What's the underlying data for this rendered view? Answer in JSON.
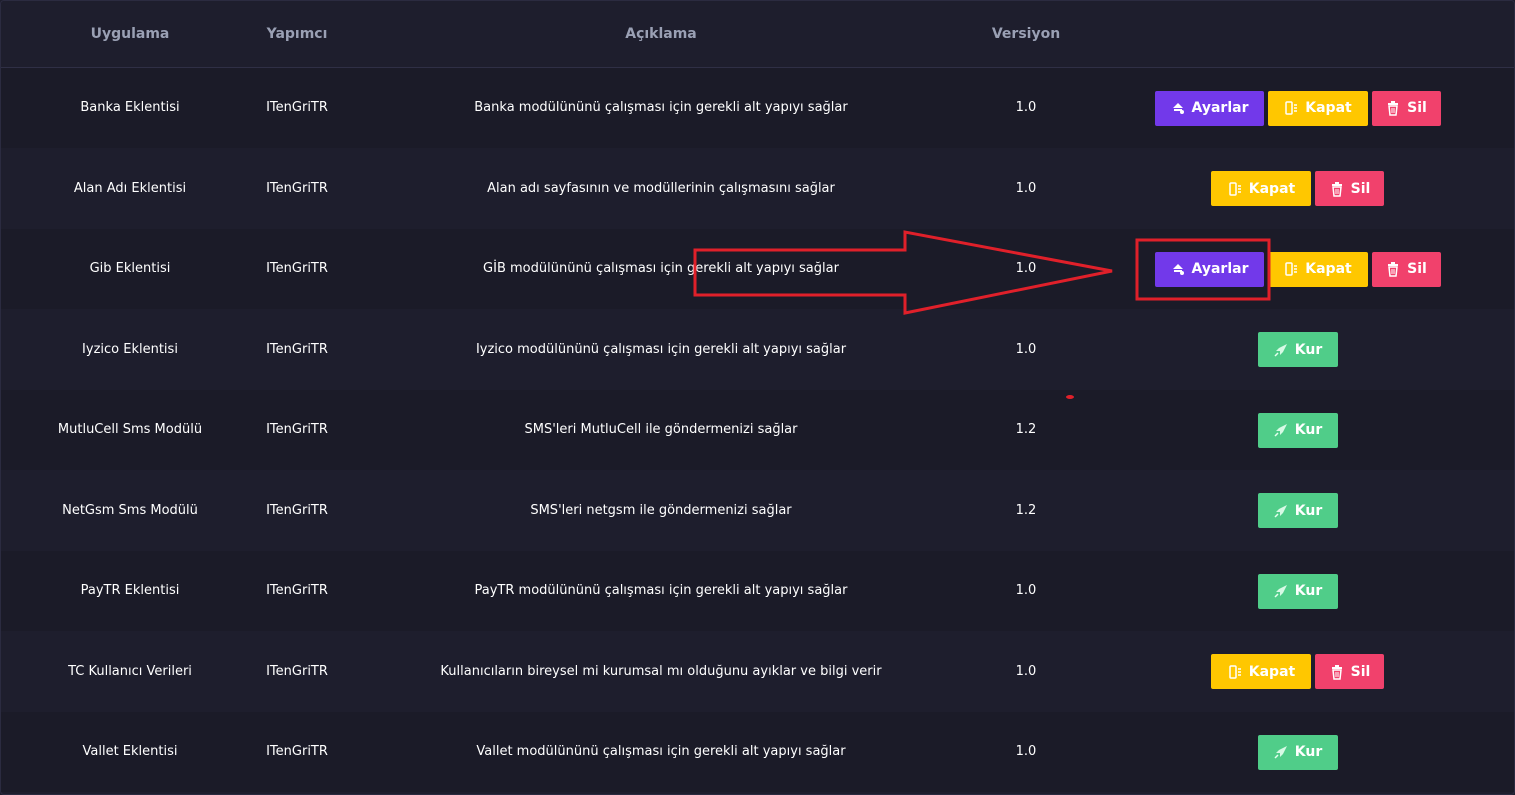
{
  "table": {
    "headers": {
      "app": "Uygulama",
      "developer": "Yapımcı",
      "description": "Açıklama",
      "version": "Versiyon"
    },
    "buttons": {
      "settings": "Ayarlar",
      "close": "Kapat",
      "delete": "Sil",
      "install": "Kur"
    },
    "rows": [
      {
        "app": "Banka Eklentisi",
        "developer": "ITenGriTR",
        "description": "Banka modülününü çalışması için gerekli alt yapıyı sağlar",
        "version": "1.0",
        "actions": [
          "settings",
          "close",
          "delete"
        ]
      },
      {
        "app": "Alan Adı Eklentisi",
        "developer": "ITenGriTR",
        "description": "Alan adı sayfasının ve modüllerinin çalışmasını sağlar",
        "version": "1.0",
        "actions": [
          "close",
          "delete"
        ]
      },
      {
        "app": "Gib Eklentisi",
        "developer": "ITenGriTR",
        "description": "GİB modülününü çalışması için gerekli alt yapıyı sağlar",
        "version": "1.0",
        "actions": [
          "settings",
          "close",
          "delete"
        ]
      },
      {
        "app": "Iyzico Eklentisi",
        "developer": "ITenGriTR",
        "description": "Iyzico modülününü çalışması için gerekli alt yapıyı sağlar",
        "version": "1.0",
        "actions": [
          "install"
        ]
      },
      {
        "app": "MutluCell Sms Modülü",
        "developer": "ITenGriTR",
        "description": "SMS'leri MutluCell ile göndermenizi sağlar",
        "version": "1.2",
        "actions": [
          "install"
        ]
      },
      {
        "app": "NetGsm Sms Modülü",
        "developer": "ITenGriTR",
        "description": "SMS'leri netgsm ile göndermenizi sağlar",
        "version": "1.2",
        "actions": [
          "install"
        ]
      },
      {
        "app": "PayTR Eklentisi",
        "developer": "ITenGriTR",
        "description": "PayTR modülününü çalışması için gerekli alt yapıyı sağlar",
        "version": "1.0",
        "actions": [
          "install"
        ]
      },
      {
        "app": "TC Kullanıcı Verileri",
        "developer": "ITenGriTR",
        "description": "Kullanıcıların bireysel mi kurumsal mı olduğunu ayıklar ve bilgi verir",
        "version": "1.0",
        "actions": [
          "close",
          "delete"
        ]
      },
      {
        "app": "Vallet Eklentisi",
        "developer": "ITenGriTR",
        "description": "Vallet modülününü çalışması için gerekli alt yapıyı sağlar",
        "version": "1.0",
        "actions": [
          "install"
        ]
      }
    ]
  },
  "colors": {
    "background": "#1e1e2d",
    "settings": "#7239ea",
    "close": "#ffc700",
    "delete": "#f1416c",
    "install": "#50cd89",
    "annotation": "#e0202a"
  },
  "icons": {
    "settings": "settings-icon",
    "close": "power-off-icon",
    "delete": "trash-icon",
    "install": "rocket-icon"
  }
}
